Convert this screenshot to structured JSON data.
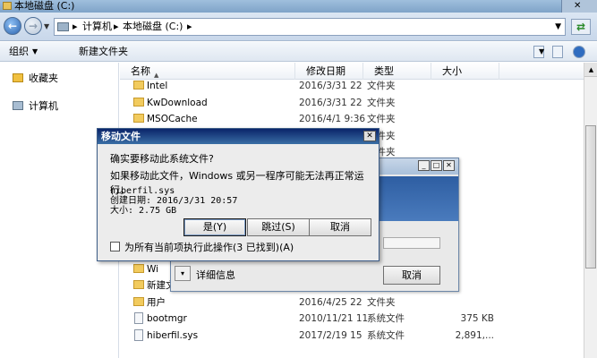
{
  "window": {
    "title": "本地磁盘 (C:)"
  },
  "address": {
    "crumb1": "计算机",
    "sep": "▸",
    "crumb2": "本地磁盘 (C:)"
  },
  "toolbar": {
    "organize": "组织",
    "new_folder": "新建文件夹"
  },
  "navpane": {
    "favorites": "收藏夹",
    "computer": "计算机"
  },
  "columns": {
    "name": "名称",
    "date": "修改日期",
    "type": "类型",
    "size": "大小"
  },
  "files": [
    {
      "name": "Intel",
      "date": "2016/3/31 22",
      "type": "文件夹",
      "size": "",
      "icon": "folder"
    },
    {
      "name": "KwDownload",
      "date": "2016/3/31 22",
      "type": "文件夹",
      "size": "",
      "icon": "folder"
    },
    {
      "name": "MSOCache",
      "date": "2016/4/1 9:36",
      "type": "文件夹",
      "size": "",
      "icon": "folder"
    },
    {
      "name": "",
      "date": "",
      "type": "文件夹",
      "size": "",
      "icon": "folder"
    },
    {
      "name": "",
      "date": "",
      "type": "文件夹",
      "size": "",
      "icon": "folder"
    },
    {
      "name": "",
      "date": "",
      "type": "文件夹",
      "size": "",
      "icon": "folder"
    },
    {
      "name": "",
      "date": "",
      "type": "",
      "size": "",
      "icon": "folder"
    },
    {
      "name": "",
      "date": "",
      "type": "",
      "size": "",
      "icon": "folder"
    },
    {
      "name": "",
      "date": "",
      "type": "",
      "size": "",
      "icon": "folder"
    },
    {
      "name": "",
      "date": "",
      "type": "",
      "size": "",
      "icon": "folder"
    },
    {
      "name": "TS",
      "date": "",
      "type": "",
      "size": "",
      "icon": "folder"
    },
    {
      "name": "Wi",
      "date": "",
      "type": "",
      "size": "",
      "icon": "folder"
    },
    {
      "name": "新建文件夹",
      "date": "2017/2/19 15",
      "type": "文件夹",
      "size": "",
      "icon": "folder"
    },
    {
      "name": "用户",
      "date": "2016/4/25 22",
      "type": "文件夹",
      "size": "",
      "icon": "folder"
    },
    {
      "name": "bootmgr",
      "date": "2010/11/21 11",
      "type": "系统文件",
      "size": "375 KB",
      "icon": "sysfile"
    },
    {
      "name": "hiberfil.sys",
      "date": "2017/2/19 15",
      "type": "系统文件",
      "size": "2,891,...",
      "icon": "sysfile"
    }
  ],
  "progress_dialog": {
    "details": "详细信息",
    "cancel": "取消"
  },
  "confirm_dialog": {
    "title": "移动文件",
    "question": "确实要移动此系统文件?",
    "warning": "如果移动此文件，Windows 或另一程序可能无法再正常运行。",
    "file_name": "hiberfil.sys",
    "created": "创建日期: 2016/3/31 20:57",
    "size": "大小: 2.75 GB",
    "yes": "是(Y)",
    "skip": "跳过(S)",
    "cancel": "取消",
    "apply_all": "为所有当前项执行此操作(3 已找到)(A)"
  }
}
